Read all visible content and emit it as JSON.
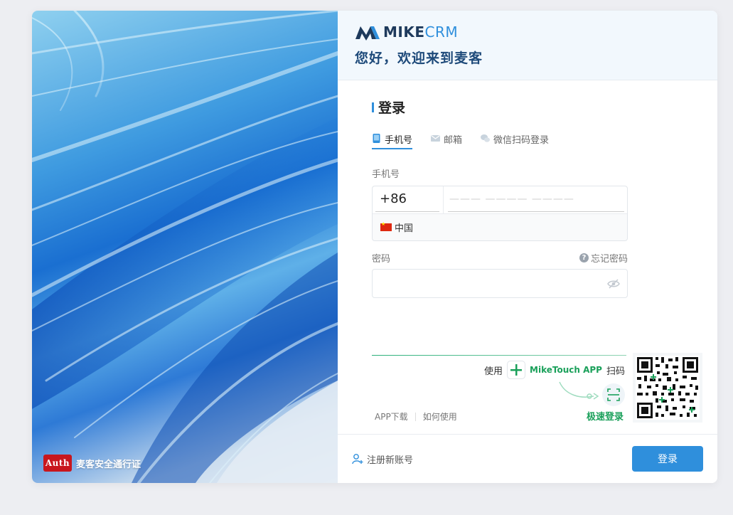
{
  "hero": {
    "badge_logo_text": "Auth",
    "badge_text": "麦客安全通行证"
  },
  "header": {
    "brand_mike": "MIKE",
    "brand_crm": "CRM",
    "welcome": "您好，欢迎来到麦客"
  },
  "form": {
    "title": "登录",
    "tabs": [
      {
        "label": "手机号",
        "icon": "phone-icon",
        "active": true
      },
      {
        "label": "邮箱",
        "icon": "mail-icon",
        "active": false
      },
      {
        "label": "微信扫码登录",
        "icon": "wechat-icon",
        "active": false
      }
    ],
    "phone_label": "手机号",
    "country_code": "+86",
    "phone_placeholder": "——— ———— ————",
    "country_name": "中国",
    "password_label": "密码",
    "forgot_label": "忘记密码",
    "password_value": ""
  },
  "app_promo": {
    "use_text": "使用",
    "app_name": "MikeTouch APP",
    "scan_text": "扫码",
    "fast_login": "极速登录",
    "app_download": "APP下载",
    "how_to_use": "如何使用"
  },
  "footer": {
    "register_label": "注册新账号",
    "login_button": "登录"
  },
  "colors": {
    "accent": "#2f8fdc",
    "green": "#1aa05a"
  }
}
